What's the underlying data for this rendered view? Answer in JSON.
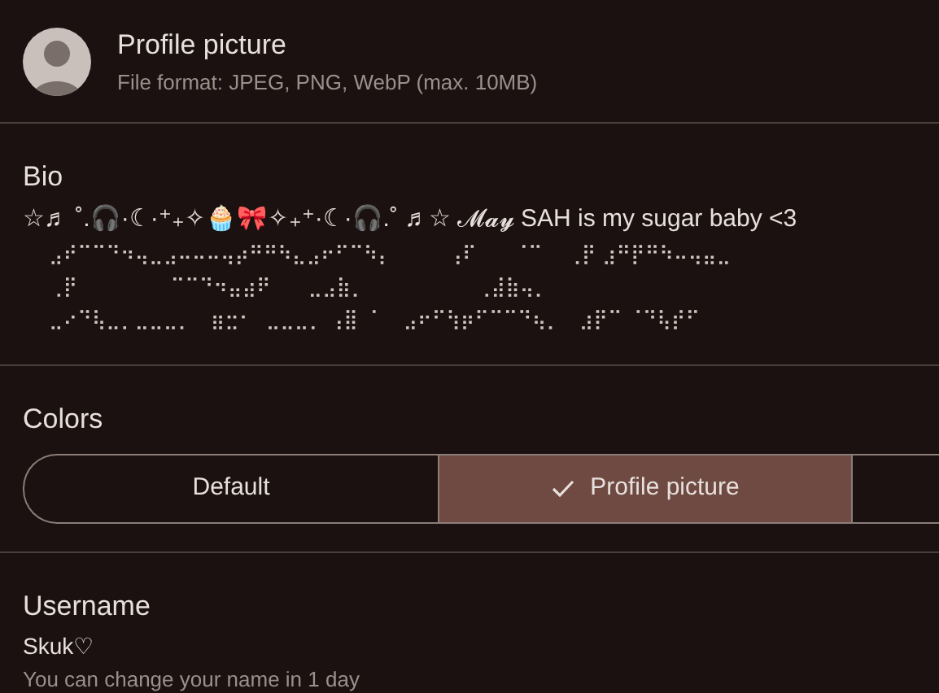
{
  "profile_picture": {
    "title": "Profile picture",
    "hint": "File format: JPEG, PNG, WebP (max. 10MB)"
  },
  "bio": {
    "label": "Bio",
    "text": "☆♬ ˚.🎧·☾·⁺₊✧🧁🎀✧₊⁺·☾·🎧.˚ ♬☆ 𝓜𝓪𝔂 SAH is my sugar baby <3",
    "art_lines": [
      "⣠⠞⠉⠉⠙⠲⢤⣀⣠⠤⠤⠤⢤⡴⠛⠛⠳⣄⣠⠖⠋⠉⠳⡄         ⢠⠏      ⠈⠉    ⢀⡟ ⣰⠛⡟⠛⠳⠤⢤⣤⣀",
      "⢀⡟               ⠉⠉⠙⠲⣤⣴⠟      ⣀⣠⣷⡀                  ⢀⣼⣷⢤⡀",
      "⣀⠔⠙⢧⣀⡀⣀⣀⣀⡀   ⣶⣒⠂  ⣀⣀⣀⡀ ⢠⣿ ⠈    ⣠⠖⠋⢳⡶⠋⠉⠉⠙⢦⡀   ⣰⡟⠉ ⠈⠙⢧⡞⠋"
    ]
  },
  "colors": {
    "label": "Colors",
    "options": [
      {
        "label": "Default",
        "selected": false
      },
      {
        "label": "Profile picture",
        "selected": true
      },
      {
        "selected": false
      }
    ]
  },
  "username": {
    "label": "Username",
    "value": "Skuk♡",
    "hint": "You can change your name in 1 day"
  }
}
